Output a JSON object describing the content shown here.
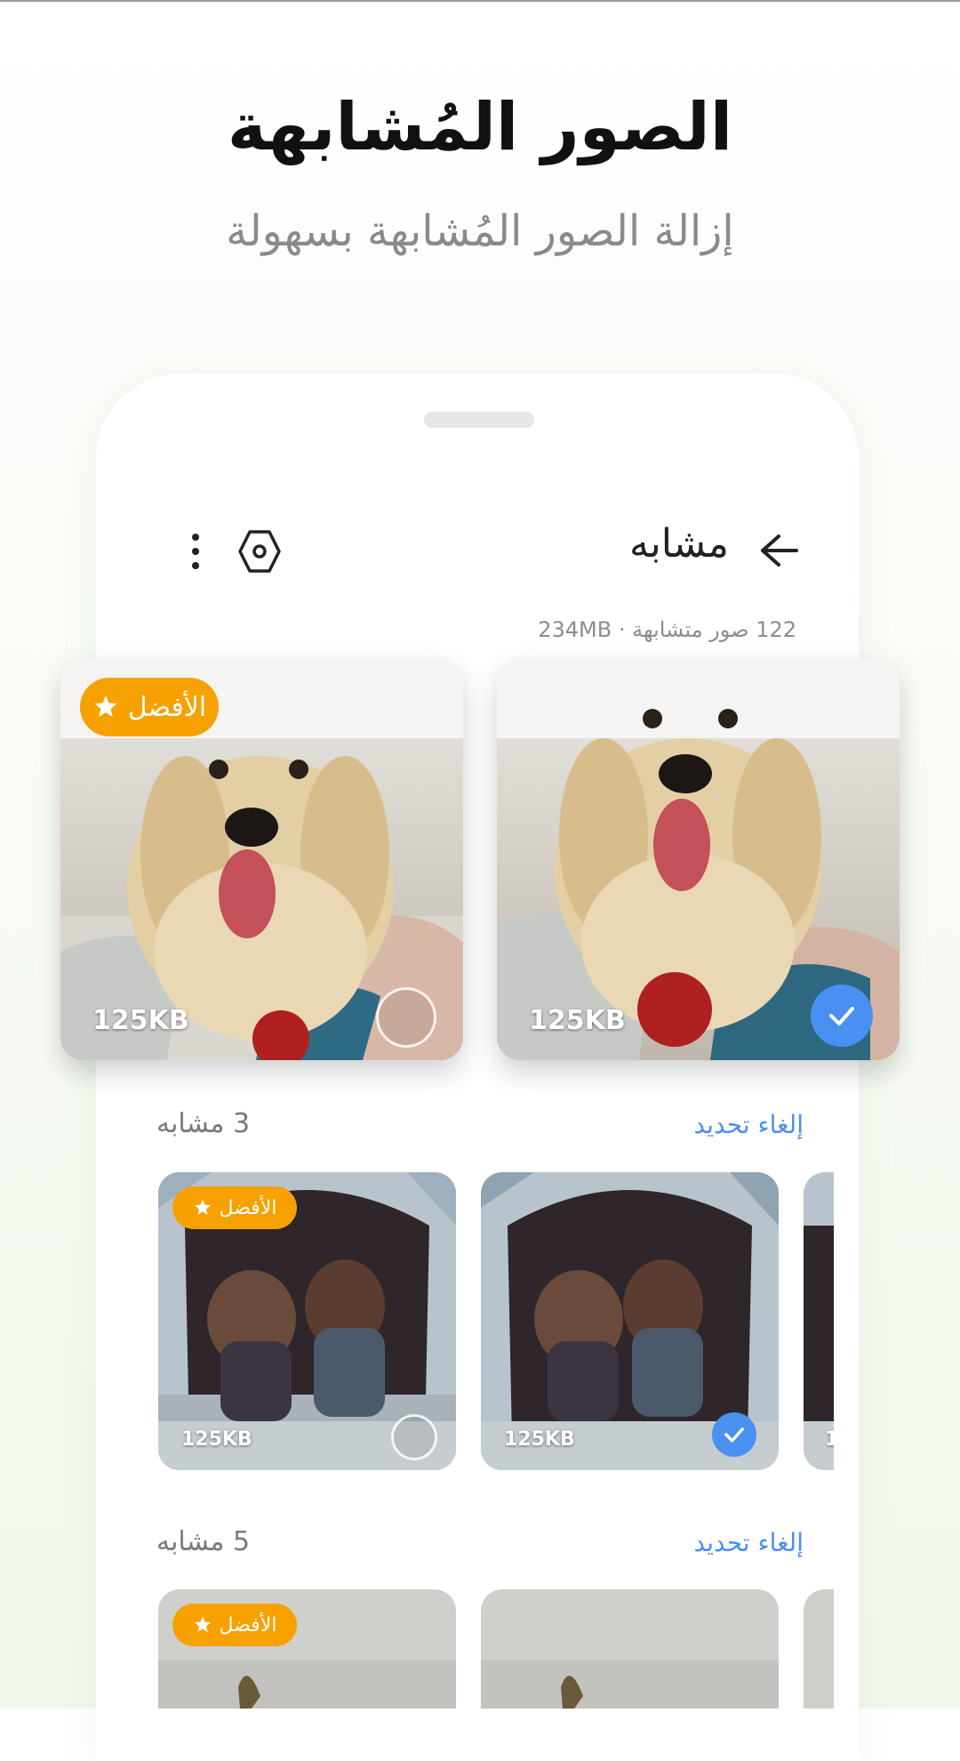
{
  "hero": {
    "title": "الصور المُشابهة",
    "subtitle": "إزالة الصور المُشابهة بسهولة"
  },
  "appbar": {
    "title": "مشابه",
    "back_icon": "arrow-right-icon",
    "settings_icon": "hexagon-settings-icon",
    "more_icon": "more-vertical-icon"
  },
  "summary": "122 صور متشابهة · 234MB",
  "colors": {
    "accent": "#4a8ff2",
    "best_badge": "#f7a100",
    "title": "#111111",
    "muted": "#8a8a8a"
  },
  "groups": [
    {
      "photos": [
        {
          "best_label": "الأفضل",
          "size": "125KB",
          "selected": false
        },
        {
          "best_label": "",
          "size": "125KB",
          "selected": true
        }
      ]
    },
    {
      "count": "3  مشابه",
      "deselect_label": "إلغاء تحديد",
      "photos": [
        {
          "best_label": "الأفضل",
          "size": "125KB",
          "selected": false
        },
        {
          "best_label": "",
          "size": "125KB",
          "selected": true
        },
        {
          "best_label": "",
          "size": "1",
          "selected": false
        }
      ]
    },
    {
      "count": "5 مشابه",
      "deselect_label": "إلغاء تحديد",
      "photos": [
        {
          "best_label": "الأفضل"
        }
      ]
    }
  ]
}
